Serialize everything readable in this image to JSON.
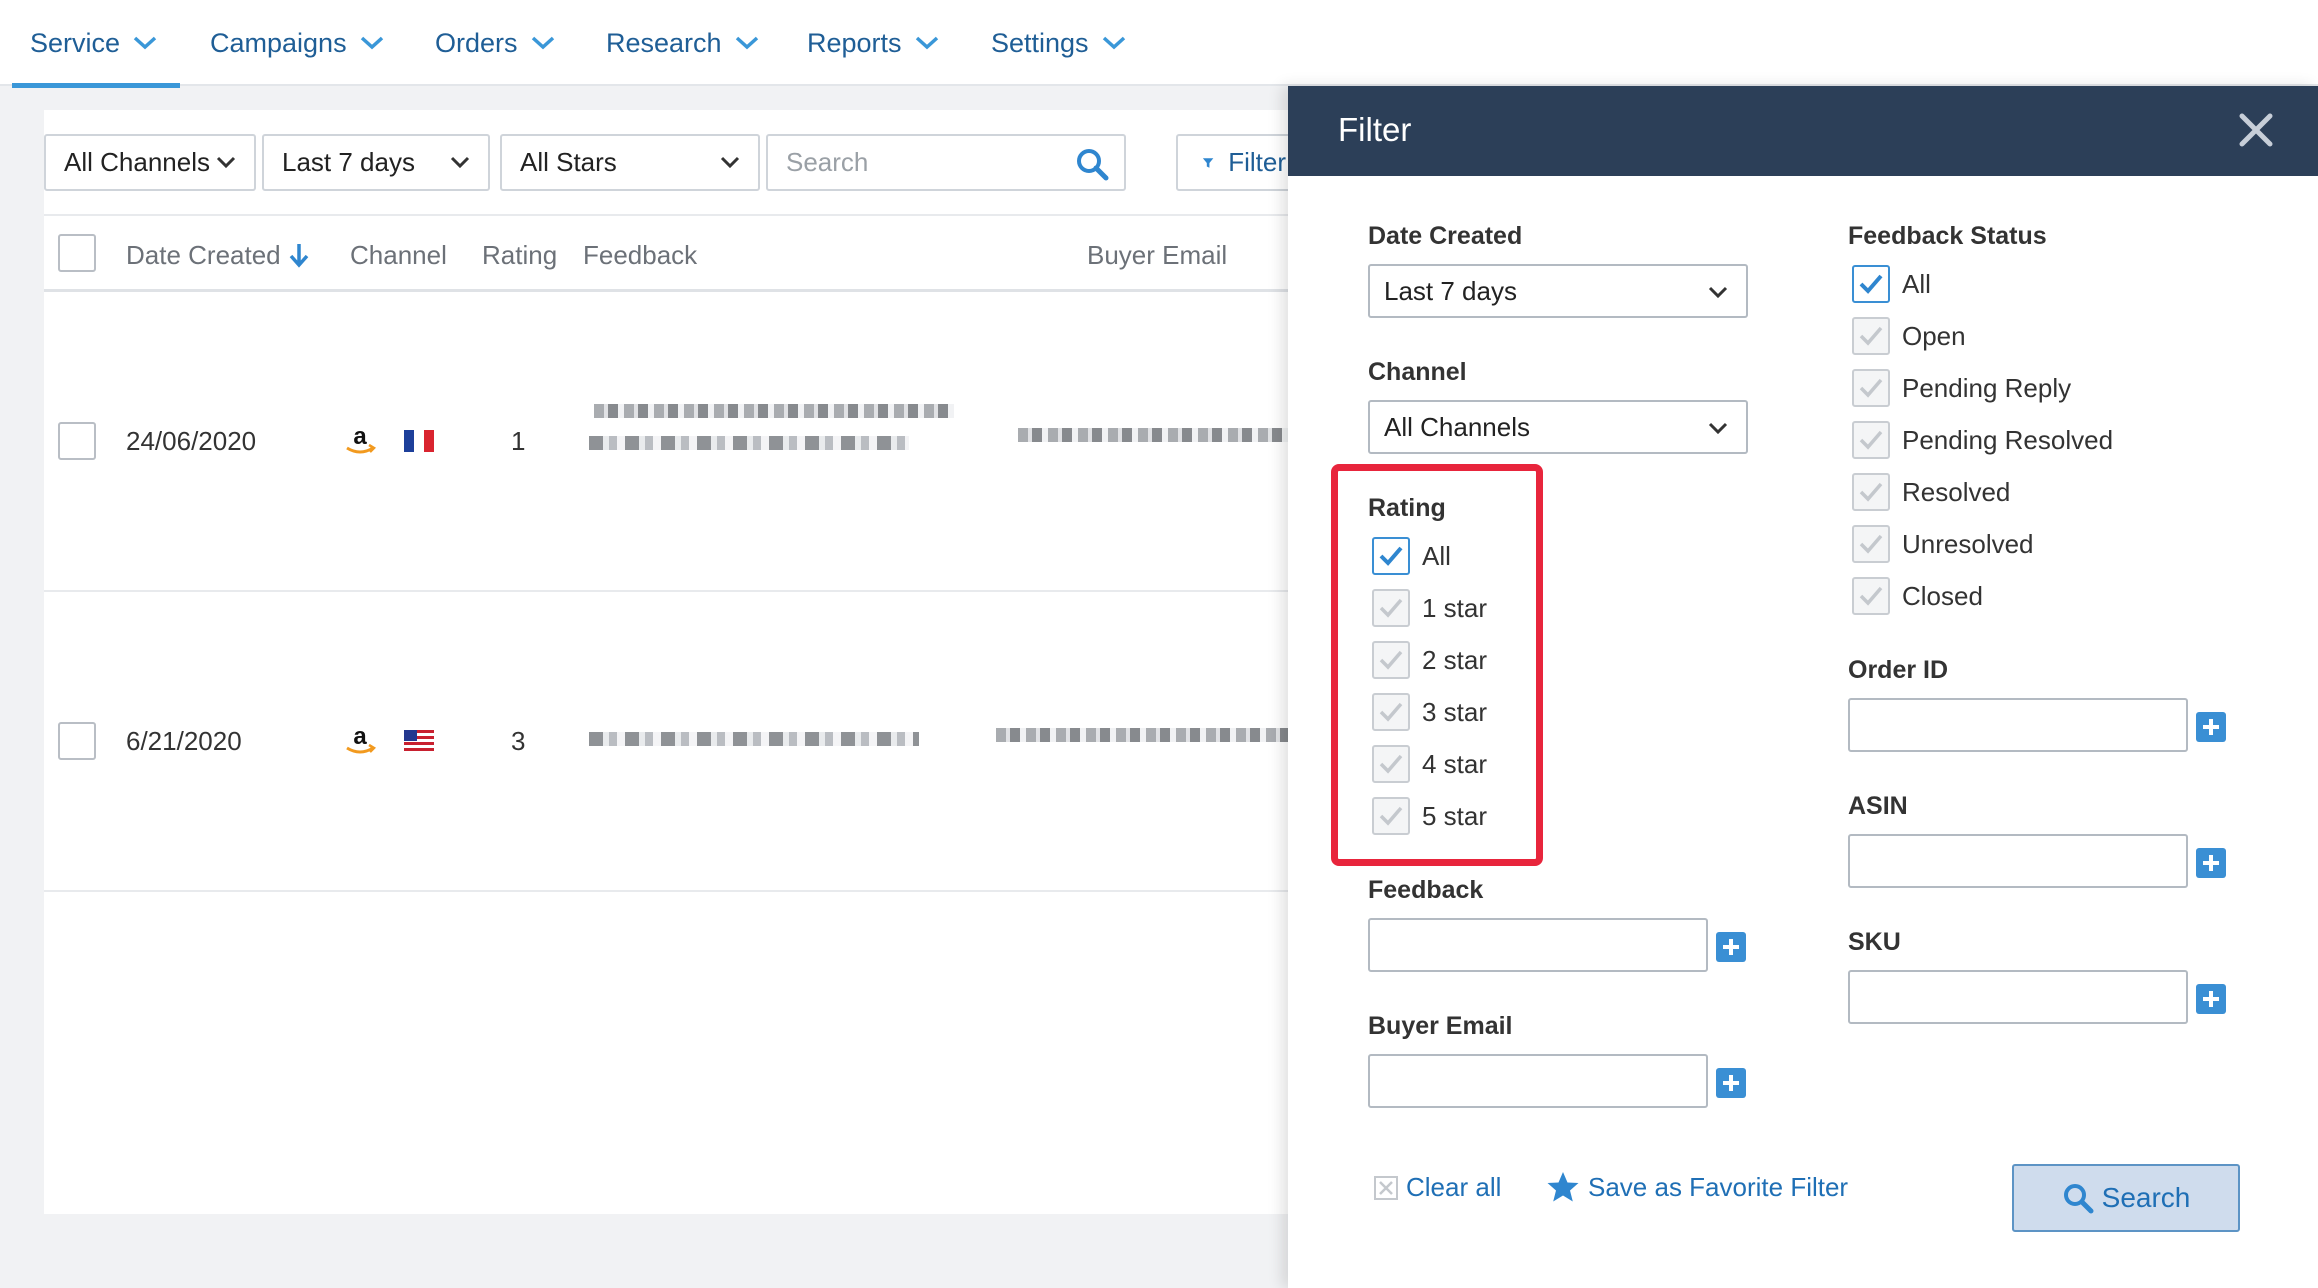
{
  "nav": {
    "items": [
      {
        "label": "Service",
        "active": true
      },
      {
        "label": "Campaigns"
      },
      {
        "label": "Orders"
      },
      {
        "label": "Research"
      },
      {
        "label": "Reports"
      },
      {
        "label": "Settings"
      }
    ]
  },
  "toolbar": {
    "channel_select": "All Channels",
    "date_select": "Last 7 days",
    "stars_select": "All Stars",
    "search_placeholder": "Search",
    "filter_button": "Filter"
  },
  "table": {
    "columns": [
      "Date Created",
      "Channel",
      "Rating",
      "Feedback",
      "Buyer Email"
    ],
    "rows": [
      {
        "date": "24/06/2020",
        "channel_icon": "amazon-icon",
        "flag": "france-flag",
        "rating": "1"
      },
      {
        "date": "6/21/2020",
        "channel_icon": "amazon-icon",
        "flag": "us-flag",
        "rating": "3"
      }
    ]
  },
  "filter_panel": {
    "title": "Filter",
    "date_created": {
      "label": "Date Created",
      "value": "Last 7 days"
    },
    "channel": {
      "label": "Channel",
      "value": "All Channels"
    },
    "rating": {
      "label": "Rating",
      "options": [
        {
          "label": "All",
          "checked": true
        },
        {
          "label": "1 star"
        },
        {
          "label": "2 star"
        },
        {
          "label": "3 star"
        },
        {
          "label": "4 star"
        },
        {
          "label": "5 star"
        }
      ]
    },
    "feedback_label": "Feedback",
    "buyer_email_label": "Buyer Email",
    "feedback_status": {
      "label": "Feedback Status",
      "options": [
        {
          "label": "All",
          "checked": true
        },
        {
          "label": "Open"
        },
        {
          "label": "Pending Reply"
        },
        {
          "label": "Pending Resolved"
        },
        {
          "label": "Resolved"
        },
        {
          "label": "Unresolved"
        },
        {
          "label": "Closed"
        }
      ]
    },
    "order_id_label": "Order ID",
    "asin_label": "ASIN",
    "sku_label": "SKU",
    "clear_all": "Clear all",
    "save_favorite": "Save as Favorite Filter",
    "search_button": "Search"
  },
  "colors": {
    "accent": "#3a97d8",
    "panel_header": "#2c3f58",
    "highlight": "#e8253c",
    "link": "#1f6fb5"
  }
}
